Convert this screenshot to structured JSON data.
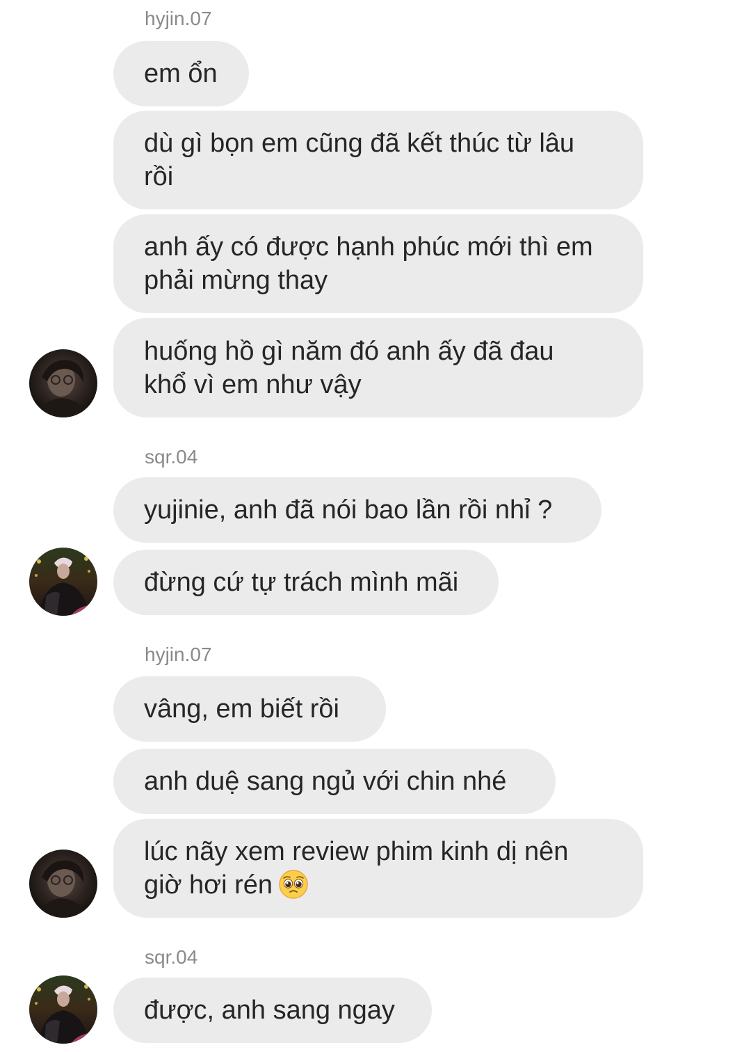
{
  "conversation": [
    {
      "sender": "hyjin.07",
      "avatar_icon": "user-avatar-hyjin",
      "messages": [
        "em ổn",
        "dù gì bọn em cũng đã kết thúc từ lâu\nrồi",
        "anh ấy có được hạnh phúc mới thì em\nphải mừng thay",
        "huống hồ gì năm đó anh ấy đã đau\nkhổ vì em như vậy"
      ]
    },
    {
      "sender": "sqr.04",
      "avatar_icon": "user-avatar-sqr",
      "messages": [
        "yujinie, anh đã nói bao lần rồi nhỉ ?",
        "đừng cứ tự trách mình mãi"
      ]
    },
    {
      "sender": "hyjin.07",
      "avatar_icon": "user-avatar-hyjin",
      "messages": [
        "vâng, em biết rồi",
        "anh duệ sang ngủ với chin nhé",
        "lúc nãy xem review phim kinh dị nên\ngiờ hơi rén"
      ],
      "emoji_icon": "pleading-face-emoji"
    },
    {
      "sender": "sqr.04",
      "avatar_icon": "user-avatar-sqr",
      "messages": [
        "được, anh sang ngay"
      ]
    }
  ],
  "colors": {
    "bubble": "#ebebeb",
    "text": "#262626",
    "sender": "#8a8a8a",
    "background": "#ffffff"
  }
}
